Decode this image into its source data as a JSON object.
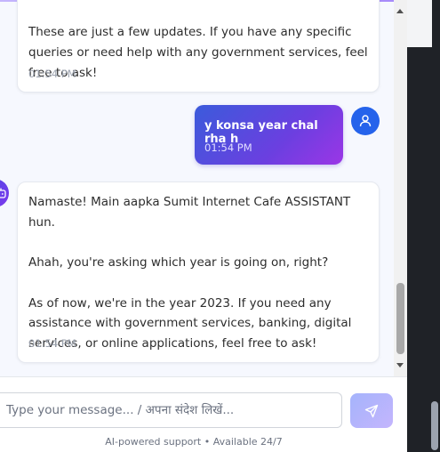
{
  "messages": [
    {
      "sender": "bot",
      "text": "These are just a few updates. If you have any specific queries or need help with any government services, feel free to ask!",
      "time": "01:54 PM"
    },
    {
      "sender": "user",
      "text": "y konsa year chal rha h",
      "time": "01:54 PM"
    },
    {
      "sender": "bot",
      "paragraphs": [
        "Namaste! Main aapka Sumit Internet Cafe ASSISTANT hun.",
        "Ahah, you're asking which year is going on, right?",
        "As of now, we're in the year 2023. If you need any assistance with government services, banking, digital services, or online applications, feel free to ask!"
      ],
      "time": "01:54 PM"
    }
  ],
  "composer": {
    "placeholder": "Type your message... / अपना संदेश लिखें...",
    "value": ""
  },
  "footer": {
    "note": "AI-powered support • Available 24/7"
  },
  "icons": {
    "user_avatar": "user-icon",
    "bot_avatar": "bot-icon",
    "send": "send-icon"
  },
  "colors": {
    "user_bubble_start": "#3b5bdb",
    "user_bubble_end": "#9b36e6",
    "user_avatar": "#2563eb",
    "send_button": "#a5b4fc"
  }
}
